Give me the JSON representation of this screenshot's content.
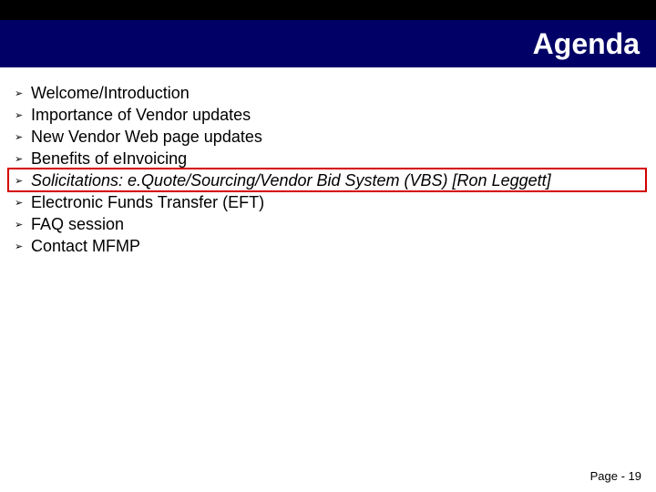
{
  "slide": {
    "title": "Agenda",
    "bullets": [
      {
        "text": "Welcome/Introduction",
        "italic": false
      },
      {
        "text": "Importance of Vendor updates",
        "italic": false
      },
      {
        "text": "New Vendor Web page updates",
        "italic": false
      },
      {
        "text": "Benefits of eInvoicing",
        "italic": false
      },
      {
        "text": "Solicitations: e.Quote/Sourcing/Vendor Bid System (VBS) [Ron Leggett]",
        "italic": true
      },
      {
        "text": "Electronic Funds Transfer (EFT)",
        "italic": false
      },
      {
        "text": "FAQ session",
        "italic": false
      },
      {
        "text": "Contact MFMP",
        "italic": false
      }
    ],
    "highlighted_index": 4,
    "footer": "Page - 19"
  },
  "colors": {
    "title_bg": "#000066",
    "highlight_border": "#d40000"
  }
}
